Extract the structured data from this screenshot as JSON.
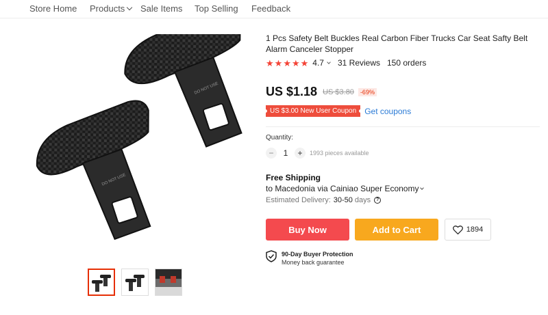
{
  "nav": {
    "items": [
      "Store Home",
      "Products",
      "Sale Items",
      "Top Selling",
      "Feedback"
    ]
  },
  "product": {
    "title": "1 Pcs Safety Belt Buckles Real Carbon Fiber Trucks Car Seat Safty Belt Alarm Canceler Stopper",
    "image_text": "DO NOT USE",
    "rating": "4.7",
    "reviews": "31 Reviews",
    "orders": "150 orders",
    "price": "US $1.18",
    "original_price": "US $3.80",
    "discount": "-69%",
    "coupon": "US $3.00 New User Coupon",
    "get_coupons": "Get coupons"
  },
  "quantity": {
    "label": "Quantity:",
    "minus": "−",
    "value": "1",
    "plus": "+",
    "available": "1993 pieces available"
  },
  "shipping": {
    "title": "Free Shipping",
    "destination": "to Macedonia via Cainiao Super Economy",
    "delivery_label": "Estimated Delivery:",
    "delivery_days": "30-50",
    "delivery_unit": "days",
    "help": "?"
  },
  "actions": {
    "buy_now": "Buy Now",
    "add_to_cart": "Add to Cart",
    "wishlist_count": "1894"
  },
  "protection": {
    "title": "90-Day Buyer Protection",
    "subtitle": "Money back guarantee"
  },
  "colors": {
    "accent_red": "#f44a4e",
    "accent_orange": "#f8a81e",
    "star": "#f44336",
    "link_blue": "#2b7bd6"
  }
}
